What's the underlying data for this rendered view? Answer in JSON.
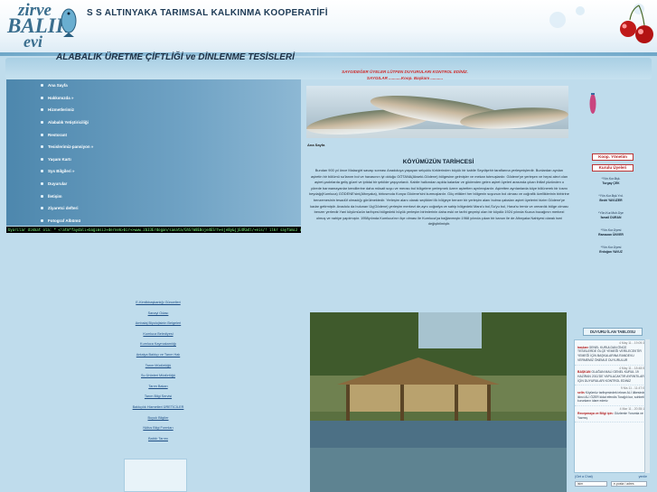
{
  "header": {
    "logo_words": [
      "zirve",
      "BALIK",
      "evi"
    ],
    "site_title": "S S ALTINYAKA TARIMSAL KALKINMA KOOPERATİFİ",
    "sub_title": "ALABALIK ÜRETME ÇİFTLİĞİ ve DİNLENME TESİSLERİ"
  },
  "menu": [
    "Ana Sayfa",
    "Hakkımızda »",
    "Hizmetlerimiz",
    "Alabalık Yetiştiriciliği",
    "Restorant",
    "Tesislerimiz-pansiyon »",
    "Yaşam Kartı",
    "Sys Bilgileri »",
    "Duyurular",
    "İletişim",
    "Ziyaretci defteri",
    "Fotograf Albümü"
  ],
  "ticker": "Uyarılar dikkat ola: * <!atm*faydalı+bağımsız+dernek>bir+>www.zb33Erdogan/sanata/GhS?m8E0oje4ES!h+nje8y&jjE4Ra4l/+eis/! ilkr sayfamız cın ofiline! ?? 0+48 ?",
  "left_links": [
    "E-Kimlikbaşkanlığı Güncelleri",
    "Sanayi Odası",
    "Ambalaj Biyolojisinin Belgeleri",
    "Kumluca Belediyesi",
    "Kumluca Kaymakamlığı",
    "Antalya Balıkçı ve Tarım Halı",
    "Tarım Müdürlüğü",
    "Su Ürünleri Müdürlüğü",
    "Tarım Bakan",
    "Tarım Bilgi Servisi",
    "Balıkçılık Hizmetleri ÜRETİCİLER",
    "Buyuk Bilgiler",
    "Nüfus Bilgi Formları",
    "Balıklı Tarımı"
  ],
  "notice": {
    "line1": "SAYGIDEĞER ÜYELER LÜTFEN DUYURULARI KONTROL EDİNİZ.",
    "line2": "SAYGILAR ...........Koop. Başkanı ..........."
  },
  "breadcrumb": "Ana Sayfa",
  "history": {
    "title": "KÖYÜMÜZÜN TARİHCESİ",
    "text": "Bundan 900 yıl önce Malazgirt savaşı sonrası Anadoluya yaşayan selçuklu türklerinden büyük bir kabile Seydişehir taraflarına yerleşmişlerdir. Bunlardan aynları aşiretin bir bölümü su'lanım bol ve havasının iyi olduğu GÖTANA(Akseki-Gödene) bölgesine gelmişler ve mekan tutmuşlardır. Gödene'ye yerleşen ve hepsi alevi olan aşiret,çadırlarda geliş güzel ve iptidai bir şekilde yaşıyorlardı. Kabile halkından açıkta kalanlar ve gödenden gelen aşiret üyeleri arasında çıkan ihtilaf yüzünden o yörede barınamayanlar kendilerine daha müsait suyu ve merası bol bölgelere yerleşmek üzere aşiretten ayrılmışlardır. Aşiretten ayrılanlarda köye bölünerek bir kısmı beydağı(Kumluca) GÖDENE'sini(Altınyaka), birkısmıda Konya Gödene'sini kurmuşlardır. Göç ettikleri her bölgenin suyunun bol olması ve coğrafik özelliklerinin birbirine benzemesinin tesadüf olmadığı görülmektedir. Yerleşim alanı olarak seçtikleri ilk bölgeye benzer bir yerleşim alanı bulma çabaları aşiret üyelerini bizim Gödene'ye kadar getirmiştir. Anadolu da bulunan Üç(Gödene) yerleşim merkezi de,aynı coğrafya ve sahip bölgedeki Mara'u bol,Su'yu bol, Hava'sı temiz ve ormanlık bölge olması benzer yerlerdir.Yani köyümüzün tarihçesi bölgedeki büyük yerleşim birimlerinin daha eski ve tarihi geçmişi olan bir köydür.1924 yılında Kuzca bucağının merkezi olmuş ve nahiye yapılmıştır. 1958yılında Kumluca'nın ilçe olması ile Kumluca'ya bağlanmıştır.1968 yılında çıkan bir kanun ile de Altınyaka Nahiyesi olarak ismi değiştirilmiştir."
  },
  "right": {
    "buttons": [
      "Koop. Yönetim",
      "Kurulu Üyeleri"
    ],
    "members": [
      {
        "role": "*Yön.Kur.Bşk.",
        "name": "Turgay ÇEK"
      },
      {
        "role": "*Yön.Kur.Bşk.Yrd.",
        "name": "Bedri YAVUZER"
      },
      {
        "role": "*Yön.Kur.Muh.Üye",
        "name": "İsmail DURAN"
      },
      {
        "role": "*Yön.Kur.Üyesi",
        "name": "Ramazan ÜNVER"
      },
      {
        "role": "*Yön.Kur.Üyesi",
        "name": "Erdoğan YAVUZ"
      }
    ],
    "panel_title": "DUYURU İLAN TABLOSU",
    "announcements": [
      {
        "date": "4 May 11 - 19:09:33",
        "author": "başkan",
        "text": "GENEL KURULDAN ÖNCE TESİSLERDE ÖLÇE YEMEĞİ VERİLECEKTİR YEMEĞİ İÇİN BAŞKALARINA RANDEVU VERMEMİZ ÖNEMLE DUYURULUR"
      },
      {
        "date": "4 May 11 - 18:48:53",
        "author": "BAŞKAN",
        "text": "OLAĞAN MALİ GENEL KURUL 19 HAZİRAN 2011'DE YAPILACAKTIR AYRINTILAR İÇİN DUYURULARI KONTROL EDİNİZ"
      },
      {
        "date": "9 Nis 11 - 11:47:04",
        "author": "selin",
        "text": "Köyümüz tarihçesindeki ekran ALİ ülkesinde ikinci ALİ ÖZER kidal efendis Torağılı kur, sohbeti kurunların idare ederiz"
      },
      {
        "date": "4 Mar 11 - 20:35:17",
        "author": "Recepmaya ve Bilgi için:",
        "text": "Gözlemle Yorumla ve Yazmış"
      }
    ],
    "panel_links": [
      "(Get a Chat)",
      "yenile"
    ],
    "inputs": [
      "isim",
      "e-posta / adres"
    ]
  }
}
